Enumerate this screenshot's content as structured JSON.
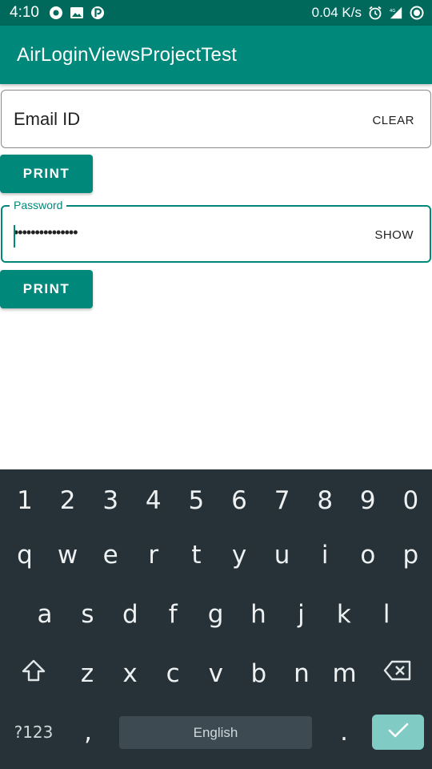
{
  "status_bar": {
    "time": "4:10",
    "net_speed": "0.04 K/s",
    "left_icons": [
      "sync-circle-icon",
      "image-icon",
      "parking-p-icon"
    ],
    "right_icons": [
      "alarm-icon",
      "signal-4g-icon",
      "record-circle-icon"
    ]
  },
  "app": {
    "title": "AirLoginViewsProjectTest",
    "primary_color": "#00897b",
    "primary_dark_color": "#00695c"
  },
  "email_field": {
    "hint": "Email ID",
    "end_action": "CLEAR"
  },
  "print_button_1": {
    "label": "PRINT"
  },
  "password_field": {
    "label": "Password",
    "value": "•••••••••••••••",
    "end_action": "SHOW"
  },
  "print_button_2": {
    "label": "PRINT"
  },
  "keyboard": {
    "background": "#263238",
    "number_row": [
      "1",
      "2",
      "3",
      "4",
      "5",
      "6",
      "7",
      "8",
      "9",
      "0"
    ],
    "row1": [
      "q",
      "w",
      "e",
      "r",
      "t",
      "y",
      "u",
      "i",
      "o",
      "p"
    ],
    "row2": [
      "a",
      "s",
      "d",
      "f",
      "g",
      "h",
      "j",
      "k",
      "l"
    ],
    "row3": [
      "z",
      "x",
      "c",
      "v",
      "b",
      "n",
      "m"
    ],
    "symbols_key": "?123",
    "comma_key": ",",
    "space_label": "English",
    "period_key": ".",
    "shift_icon": "shift-arrow-icon",
    "delete_icon": "backspace-icon",
    "enter_icon": "checkmark-icon",
    "enter_color": "#80cbc4"
  }
}
